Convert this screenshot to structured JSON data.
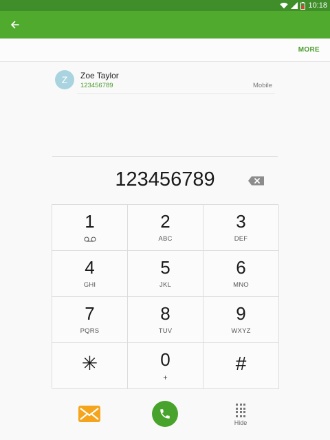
{
  "status_bar": {
    "time": "10:18",
    "icons": [
      "wifi-icon",
      "signal-icon",
      "battery-icon"
    ]
  },
  "toolbar": {
    "back_icon": "arrow-left-icon",
    "more_label": "MORE"
  },
  "suggestion": {
    "avatar_initial": "Z",
    "name": "Zoe Taylor",
    "number": "123456789",
    "type": "Mobile"
  },
  "dialer": {
    "number": "123456789",
    "backspace_icon": "backspace-icon"
  },
  "keys": [
    {
      "digit": "1",
      "letters": "",
      "icon": "voicemail-icon"
    },
    {
      "digit": "2",
      "letters": "ABC"
    },
    {
      "digit": "3",
      "letters": "DEF"
    },
    {
      "digit": "4",
      "letters": "GHI"
    },
    {
      "digit": "5",
      "letters": "JKL"
    },
    {
      "digit": "6",
      "letters": "MNO"
    },
    {
      "digit": "7",
      "letters": "PQRS"
    },
    {
      "digit": "8",
      "letters": "TUV"
    },
    {
      "digit": "9",
      "letters": "WXYZ"
    },
    {
      "digit": "✳",
      "letters": ""
    },
    {
      "digit": "0",
      "letters": "+"
    },
    {
      "digit": "#",
      "letters": ""
    }
  ],
  "actions": {
    "message_icon": "envelope-icon",
    "call_icon": "phone-icon",
    "hide_label": "Hide"
  },
  "colors": {
    "status_bar": "#3f8e2a",
    "app_bar": "#50aa2e",
    "accent": "#4a9b2b",
    "message": "#f4a51d",
    "call": "#47a32c"
  }
}
